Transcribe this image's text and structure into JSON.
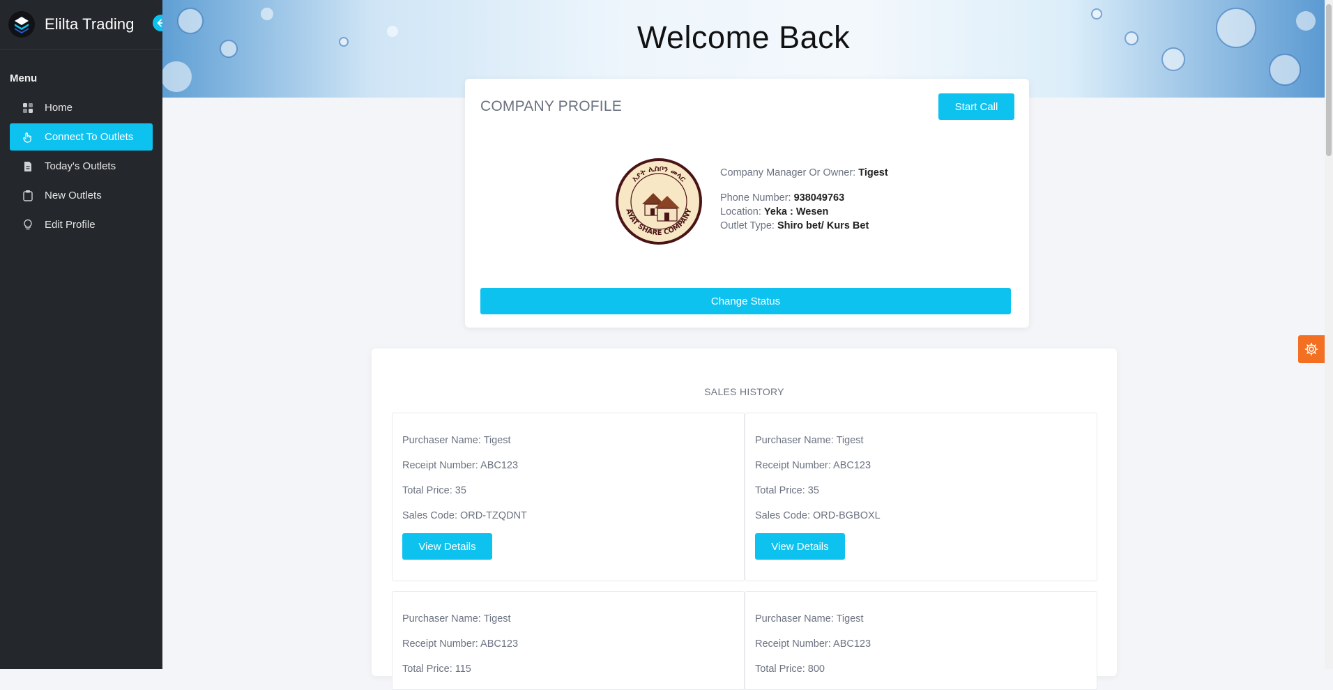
{
  "app": {
    "name": "Elilta Trading"
  },
  "sidebar": {
    "menu_title": "Menu",
    "items": [
      {
        "label": "Home",
        "icon": "grid-icon",
        "active": false
      },
      {
        "label": "Connect To Outlets",
        "icon": "hand-icon",
        "active": true
      },
      {
        "label": "Today's Outlets",
        "icon": "document-icon",
        "active": false
      },
      {
        "label": "New Outlets",
        "icon": "clipboard-icon",
        "active": false
      },
      {
        "label": "Edit Profile",
        "icon": "lightbulb-icon",
        "active": false
      }
    ]
  },
  "header": {
    "title": "Welcome Back"
  },
  "profile": {
    "title": "COMPANY PROFILE",
    "start_call_label": "Start Call",
    "manager_label": "Company Manager Or Owner:",
    "manager_value": "Tigest",
    "phone_label": "Phone Number:",
    "phone_value": "938049763",
    "location_label": "Location:",
    "location_value": "Yeka : Wesen",
    "outlet_type_label": "Outlet Type:",
    "outlet_type_value": "Shiro bet/ Kurs Bet",
    "change_status_label": "Change Status",
    "logo_text_top": "አያት ሊስቦን መላር",
    "logo_text_bottom": "AYAT SHARE COMPANY"
  },
  "sales": {
    "title": "SALES HISTORY",
    "records": [
      {
        "purchaser": "Purchaser Name: Tigest",
        "receipt": "Receipt Number: ABC123",
        "total": "Total Price: 35",
        "code": "Sales Code: ORD-TZQDNT",
        "button": "View Details"
      },
      {
        "purchaser": "Purchaser Name: Tigest",
        "receipt": "Receipt Number: ABC123",
        "total": "Total Price: 35",
        "code": "Sales Code: ORD-BGBOXL",
        "button": "View Details"
      },
      {
        "purchaser": "Purchaser Name: Tigest",
        "receipt": "Receipt Number: ABC123",
        "total": "Total Price: 115"
      },
      {
        "purchaser": "Purchaser Name: Tigest",
        "receipt": "Receipt Number: ABC123",
        "total": "Total Price: 800"
      }
    ]
  },
  "colors": {
    "accent": "#0ec2f0",
    "sidebar": "#24272b",
    "settings": "#f36f21"
  }
}
